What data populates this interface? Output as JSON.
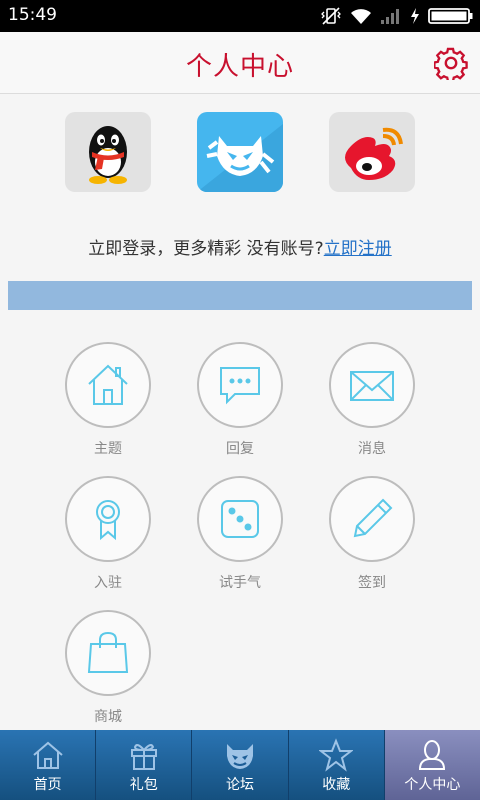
{
  "status_bar": {
    "time": "15:49"
  },
  "header": {
    "title": "个人中心"
  },
  "login": {
    "providers": [
      "qq",
      "app",
      "weibo"
    ],
    "prompt_text": "立即登录，更多精彩 没有账号?",
    "register_link": "立即注册"
  },
  "menu": {
    "items": [
      {
        "label": "主题",
        "icon": "home-icon"
      },
      {
        "label": "回复",
        "icon": "chat-bubble-icon"
      },
      {
        "label": "消息",
        "icon": "envelope-icon"
      },
      {
        "label": "入驻",
        "icon": "ribbon-badge-icon"
      },
      {
        "label": "试手气",
        "icon": "dice-icon"
      },
      {
        "label": "签到",
        "icon": "pencil-icon"
      },
      {
        "label": "商城",
        "icon": "shopping-bag-icon"
      }
    ]
  },
  "tabs": {
    "items": [
      {
        "label": "首页",
        "icon": "home-icon"
      },
      {
        "label": "礼包",
        "icon": "gift-icon"
      },
      {
        "label": "论坛",
        "icon": "mascot-icon"
      },
      {
        "label": "收藏",
        "icon": "star-icon"
      },
      {
        "label": "个人中心",
        "icon": "person-icon"
      }
    ],
    "active": "个人中心"
  },
  "colors": {
    "title": "#c8102e",
    "link": "#2472c8",
    "banner": "#92b8de",
    "tabbar": "#1c5d96",
    "icon_outline": "#5ac8e8"
  }
}
